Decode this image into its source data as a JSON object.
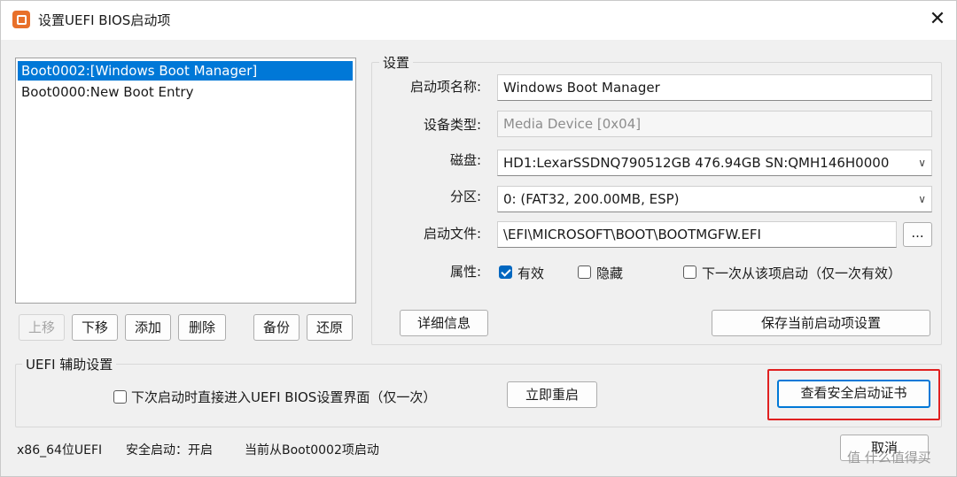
{
  "window": {
    "title": "设置UEFI BIOS启动项",
    "close_glyph": "✕"
  },
  "boot_list": [
    {
      "label": "Boot0002:[Windows Boot Manager]",
      "selected": true
    },
    {
      "label": "Boot0000:New Boot Entry",
      "selected": false
    }
  ],
  "list_buttons": {
    "up": "上移",
    "down": "下移",
    "add": "添加",
    "delete": "删除",
    "backup": "备份",
    "restore": "还原"
  },
  "settings": {
    "group_title": "设置",
    "name_label": "启动项名称:",
    "name_value": "Windows Boot Manager",
    "device_type_label": "设备类型:",
    "device_type_value": "Media Device [0x04]",
    "disk_label": "磁盘:",
    "disk_value": "HD1:LexarSSDNQ790512GB 476.94GB SN:QMH146H0000",
    "partition_label": "分区:",
    "partition_value": "0: (FAT32, 200.00MB, ESP)",
    "file_label": "启动文件:",
    "file_value": "\\EFI\\MICROSOFT\\BOOT\\BOOTMGFW.EFI",
    "browse_label": "...",
    "attr_label": "属性:",
    "attr_valid": "有效",
    "attr_hidden": "隐藏",
    "attr_next_once": "下一次从该项启动（仅一次有效）",
    "details_button": "详细信息",
    "save_button": "保存当前启动项设置"
  },
  "uefi_aux": {
    "group_title": "UEFI 辅助设置",
    "enter_bios_next": "下次启动时直接进入UEFI BIOS设置界面（仅一次）",
    "reboot_button": "立即重启",
    "view_cert_button": "查看安全启动证书"
  },
  "status": {
    "arch": "x86_64位UEFI",
    "secure_boot": "安全启动：开启",
    "current": "当前从Boot0002项启动"
  },
  "cancel_button": "取消",
  "watermark": "值 什么值得买"
}
